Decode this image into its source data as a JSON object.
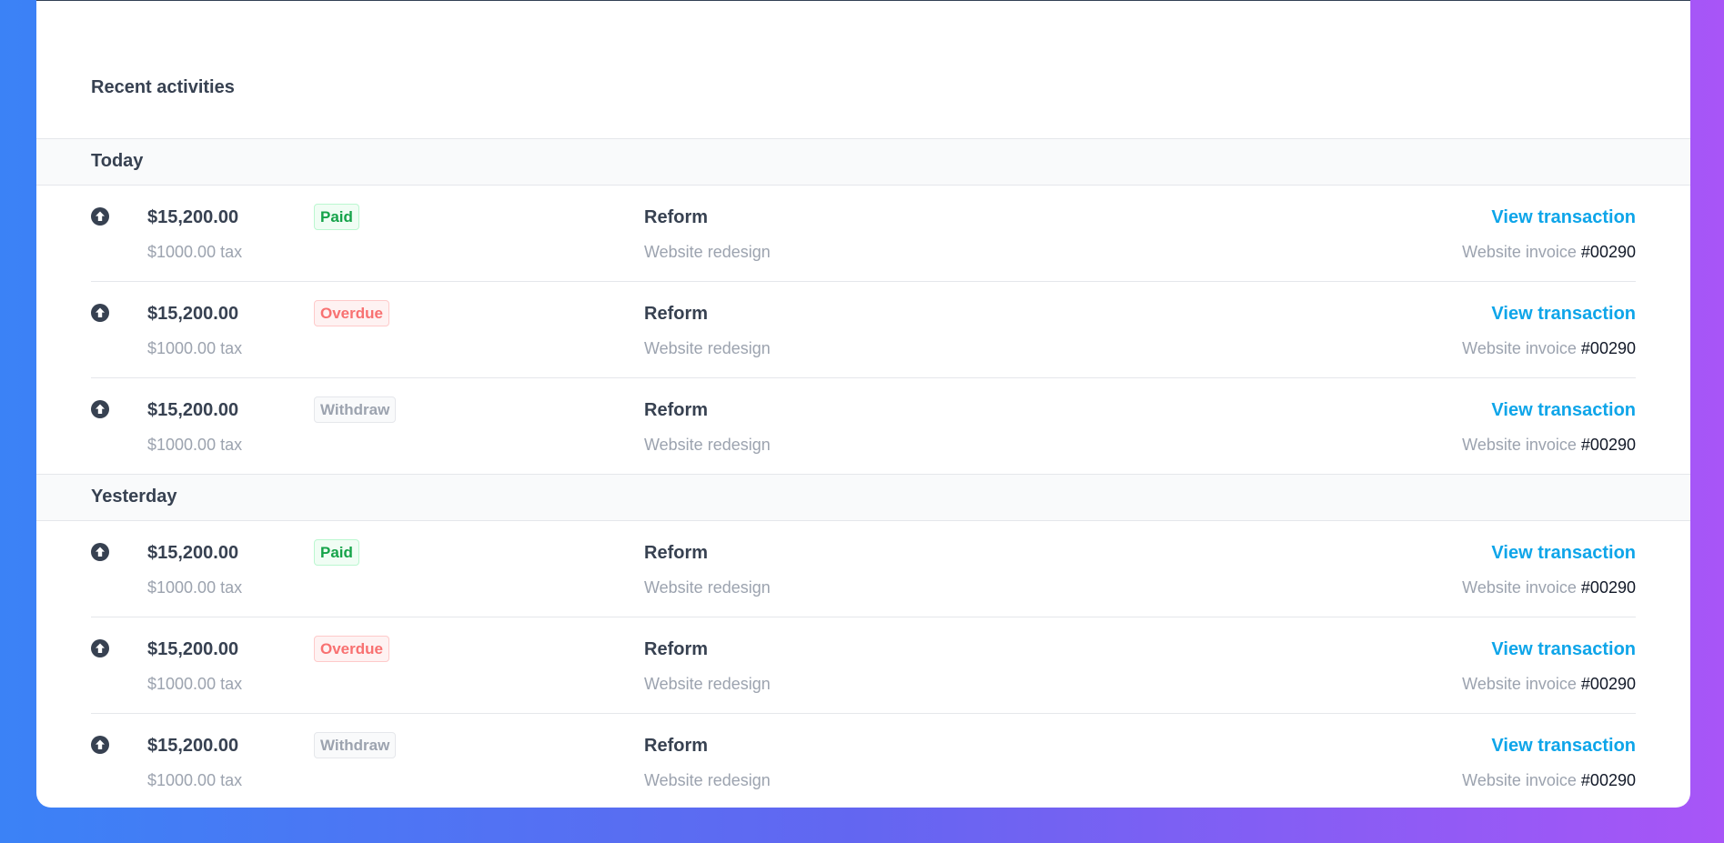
{
  "panel": {
    "title": "Recent activities"
  },
  "groups": [
    {
      "label": "Today",
      "rows": [
        {
          "amount": "$15,200.00",
          "tax": "$1000.00 tax",
          "status": "Paid",
          "client": "Reform",
          "project": "Website redesign",
          "action": "View transaction",
          "invoice_label": "Website invoice",
          "invoice_number": "#00290"
        },
        {
          "amount": "$15,200.00",
          "tax": "$1000.00 tax",
          "status": "Overdue",
          "client": "Reform",
          "project": "Website redesign",
          "action": "View transaction",
          "invoice_label": "Website invoice",
          "invoice_number": "#00290"
        },
        {
          "amount": "$15,200.00",
          "tax": "$1000.00 tax",
          "status": "Withdraw",
          "client": "Reform",
          "project": "Website redesign",
          "action": "View transaction",
          "invoice_label": "Website invoice",
          "invoice_number": "#00290"
        }
      ]
    },
    {
      "label": "Yesterday",
      "rows": [
        {
          "amount": "$15,200.00",
          "tax": "$1000.00 tax",
          "status": "Paid",
          "client": "Reform",
          "project": "Website redesign",
          "action": "View transaction",
          "invoice_label": "Website invoice",
          "invoice_number": "#00290"
        },
        {
          "amount": "$15,200.00",
          "tax": "$1000.00 tax",
          "status": "Overdue",
          "client": "Reform",
          "project": "Website redesign",
          "action": "View transaction",
          "invoice_label": "Website invoice",
          "invoice_number": "#00290"
        },
        {
          "amount": "$15,200.00",
          "tax": "$1000.00 tax",
          "status": "Withdraw",
          "client": "Reform",
          "project": "Website redesign",
          "action": "View transaction",
          "invoice_label": "Website invoice",
          "invoice_number": "#00290"
        }
      ]
    }
  ],
  "icons": {
    "row_icon": "arrow-up-circle-icon"
  },
  "colors": {
    "paid": "#16a34a",
    "overdue": "#f87171",
    "withdraw": "#9ca3af",
    "link": "#0ea5e9"
  }
}
